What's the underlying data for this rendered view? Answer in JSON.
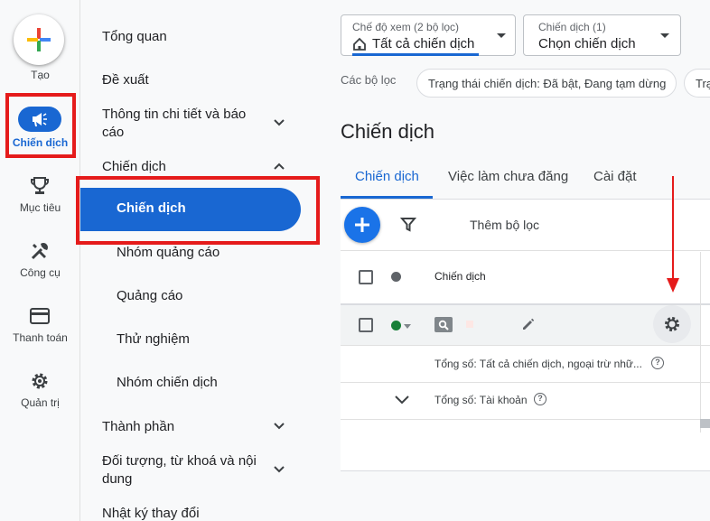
{
  "rail": {
    "create_label": "Tạo",
    "items": [
      {
        "label": "Chiến dịch",
        "icon": "megaphone-icon"
      },
      {
        "label": "Mục tiêu",
        "icon": "trophy-icon"
      },
      {
        "label": "Công cụ",
        "icon": "tools-icon"
      },
      {
        "label": "Thanh toán",
        "icon": "credit-card-icon"
      },
      {
        "label": "Quản trị",
        "icon": "gear-icon"
      }
    ]
  },
  "nav": {
    "overview": "Tổng quan",
    "recommendations": "Đề xuất",
    "insights": "Thông tin chi tiết và báo cáo",
    "campaigns_group": "Chiến dịch",
    "campaigns_active": "Chiến dịch",
    "ad_groups": "Nhóm quảng cáo",
    "ads": "Quảng cáo",
    "experiments": "Thử nghiệm",
    "campaign_groups": "Nhóm chiến dịch",
    "assets": "Thành phần",
    "audiences": "Đối tượng, từ khoá và nội dung",
    "change_history": "Nhật ký thay đổi"
  },
  "header": {
    "view_mode_small": "Chế độ xem (2 bộ lọc)",
    "view_mode_value": "Tất cả chiến dịch",
    "campaign_small": "Chiến dịch (1)",
    "campaign_value": "Chọn chiến dịch",
    "filters_label": "Các bộ lọc",
    "filter_chip_1": "Trạng thái chiến dịch: Đã bật, Đang tạm dừng",
    "filter_chip_2": "Trạ"
  },
  "page": {
    "title": "Chiến dịch",
    "tabs": [
      "Chiến dịch",
      "Việc làm chưa đăng",
      "Cài đặt"
    ]
  },
  "table": {
    "add_filter": "Thêm bộ lọc",
    "column_campaign": "Chiến dịch",
    "total_all": "Tổng số: Tất cả chiến dịch, ngoại trừ nhữ...",
    "total_account": "Tổng số: Tài khoản",
    "help_glyph": "?"
  },
  "colors": {
    "accent": "#1967d2",
    "highlight_red": "#e51b1b",
    "status_enabled": "#188038"
  }
}
